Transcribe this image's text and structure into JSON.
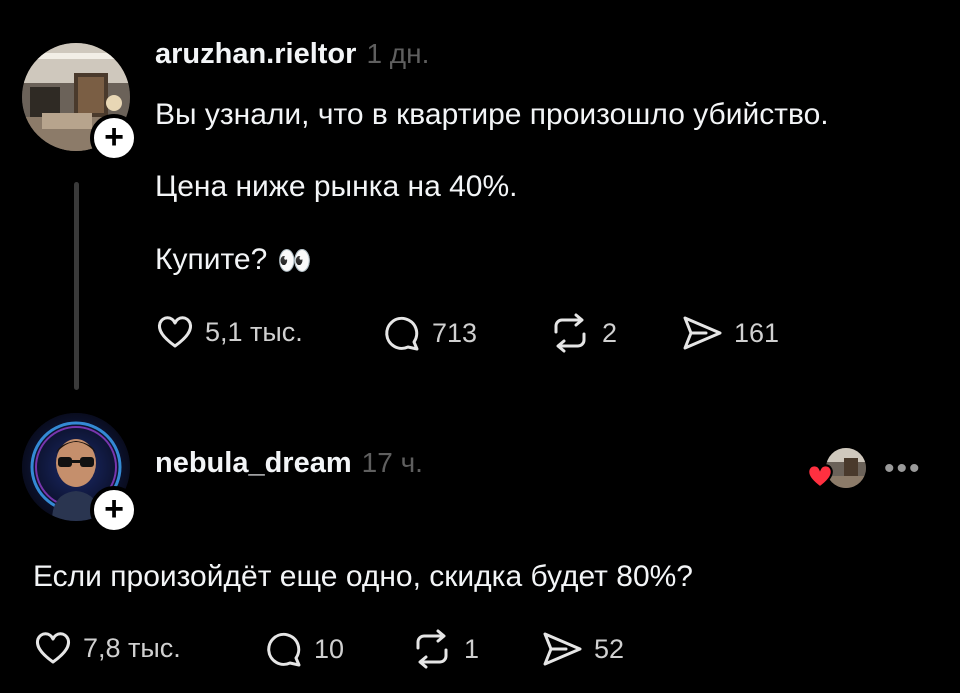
{
  "post": {
    "username": "aruzhan.rieltor",
    "time": "1 дн.",
    "line1": "Вы узнали, что в квартире произошло убийство.",
    "line2": "Цена ниже рынка на 40%.",
    "line3": "Купите?",
    "emoji": "👀",
    "likes": "5,1 тыс.",
    "comments": "713",
    "reposts": "2",
    "shares": "161"
  },
  "reply": {
    "username": "nebula_dream",
    "time": "17 ч.",
    "text": "Если произойдёт еще одно, скидка будет 80%?",
    "likes": "7,8 тыс.",
    "comments": "10",
    "reposts": "1",
    "shares": "52",
    "more": "•••"
  },
  "icons": {
    "follow": "+",
    "like": "heart-icon",
    "comment": "comment-icon",
    "repost": "repost-icon",
    "share": "share-icon"
  },
  "colors": {
    "background": "#000000",
    "text": "#f3f5f7",
    "muted": "#5f5f5f",
    "liked_heart": "#ff3040"
  }
}
